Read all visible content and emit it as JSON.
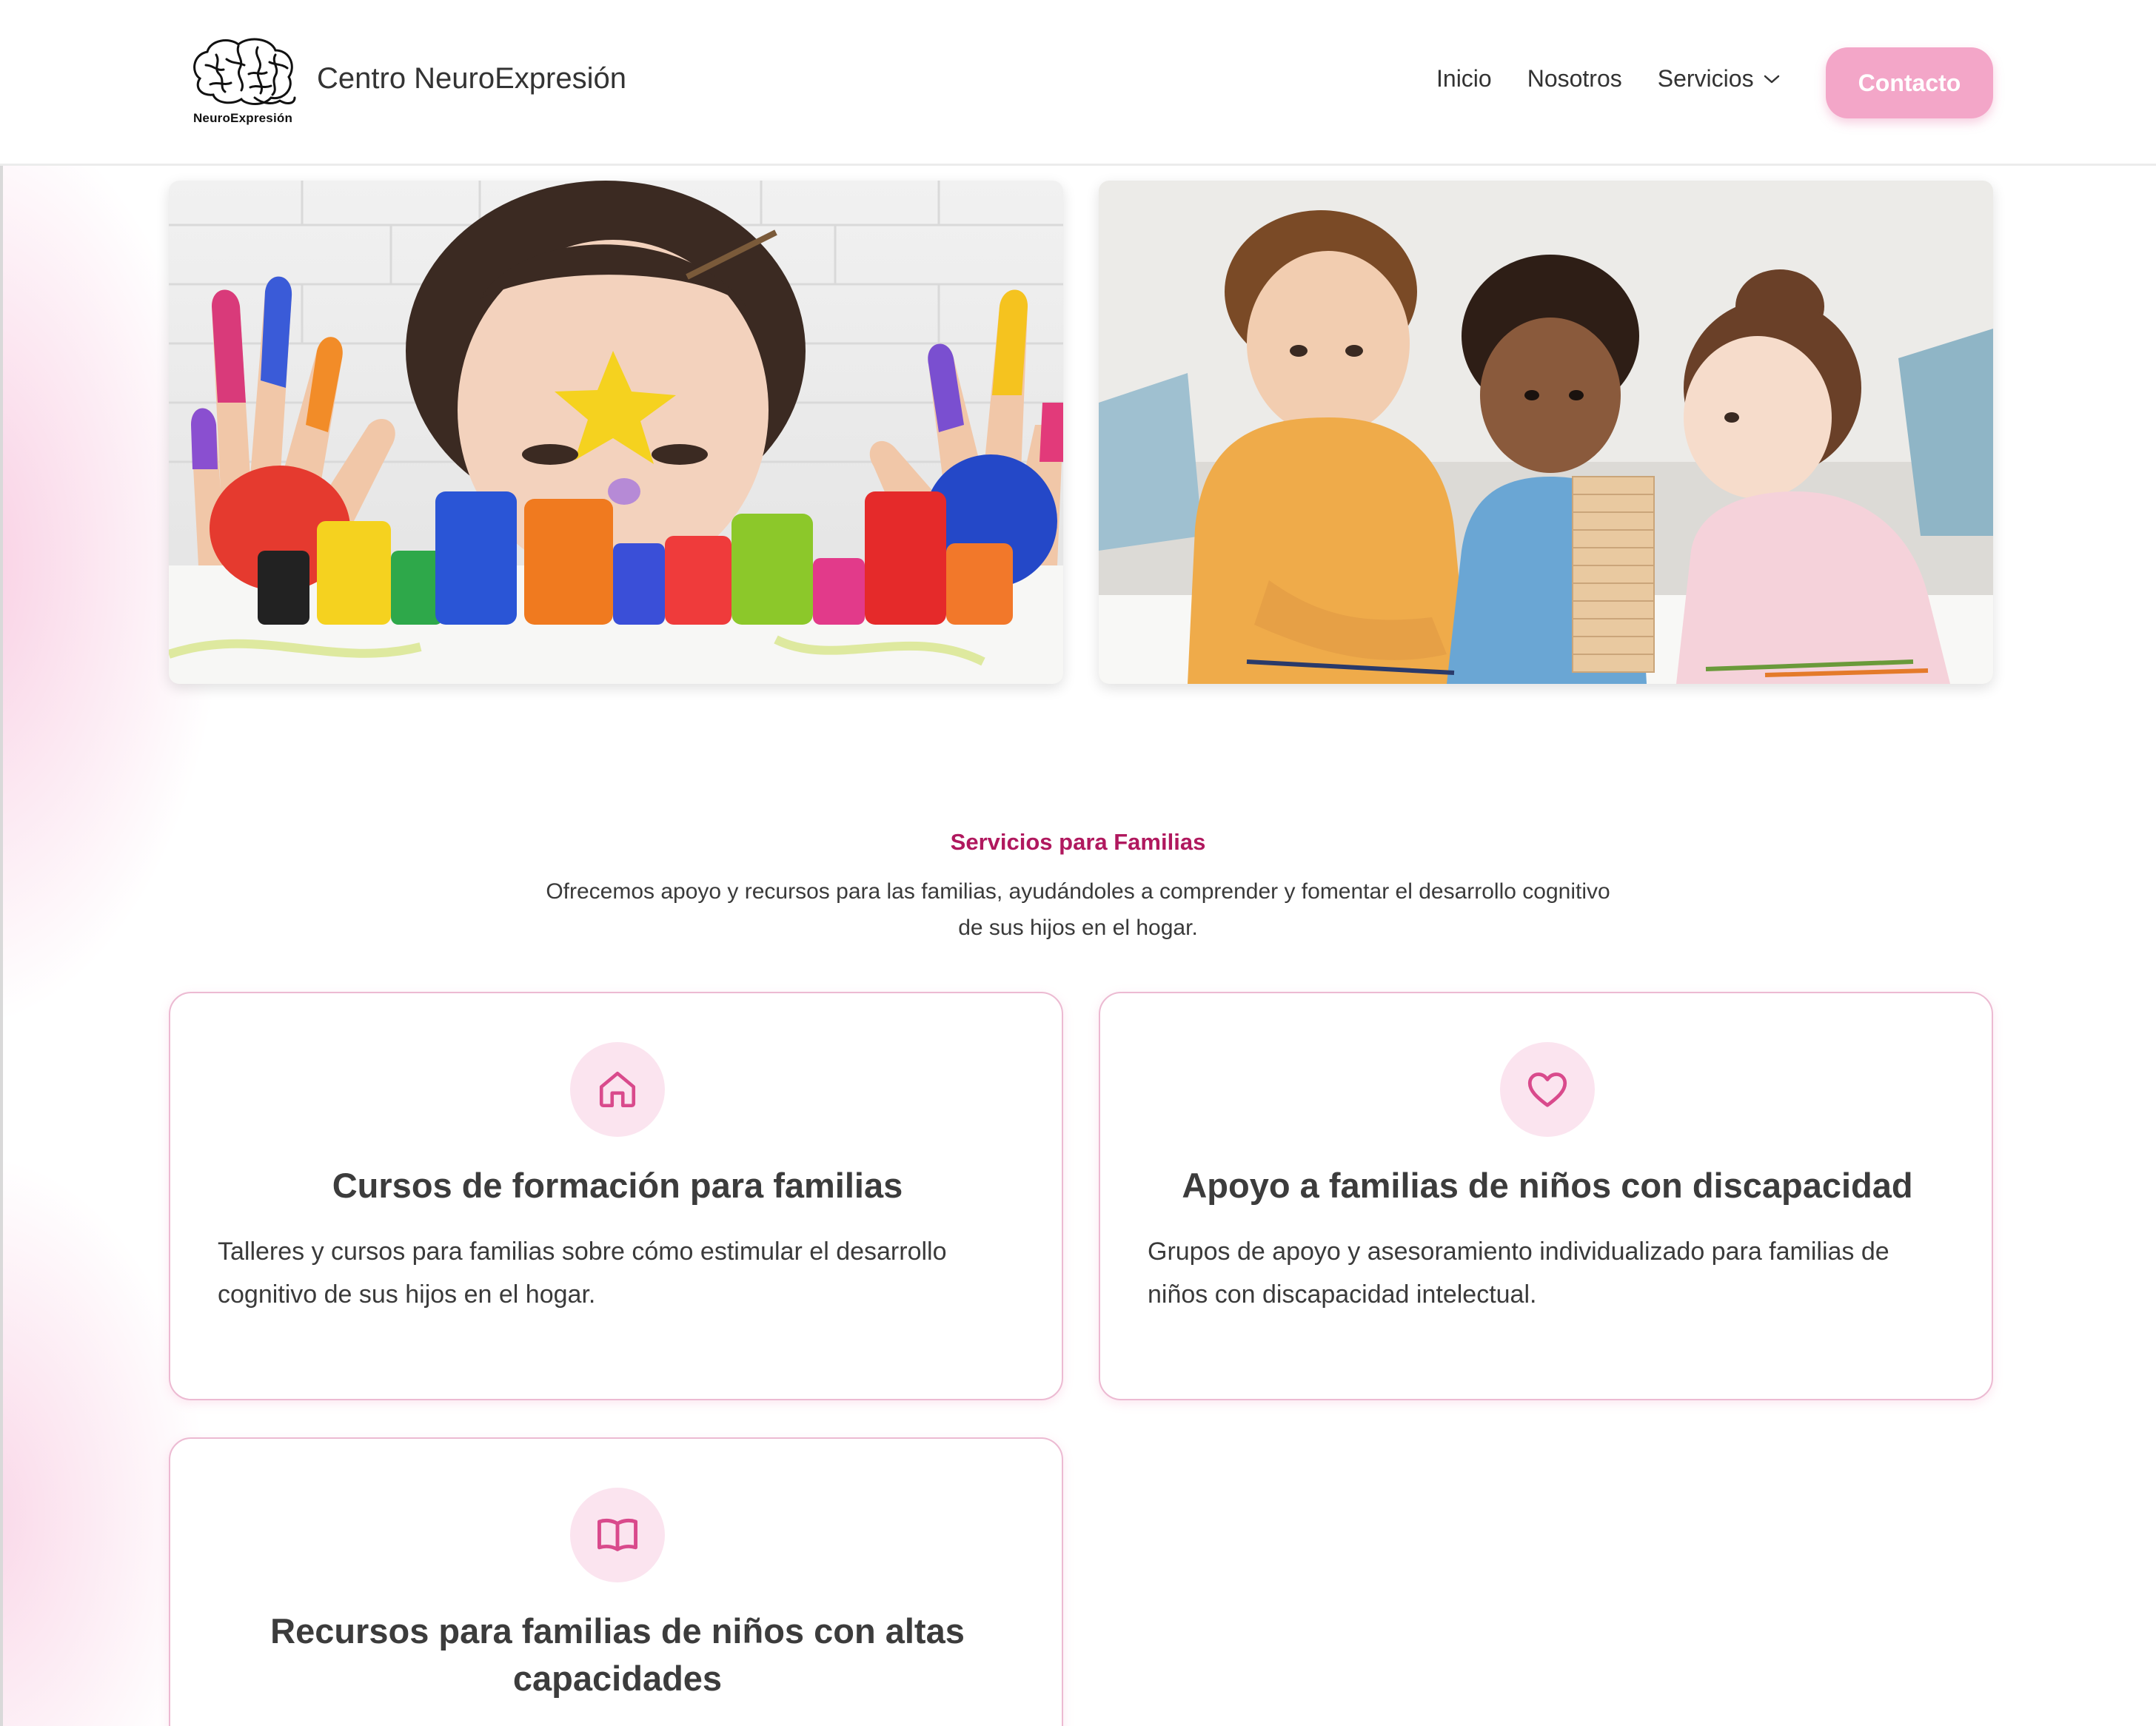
{
  "header": {
    "logo_caption": "NeuroExpresión",
    "brand_name": "Centro NeuroExpresión",
    "nav": [
      {
        "label": "Inicio"
      },
      {
        "label": "Nosotros"
      },
      {
        "label": "Servicios"
      }
    ],
    "contact_label": "Contacto"
  },
  "colors": {
    "accent_pink": "#f3a6c8",
    "section_title": "#b0185e",
    "icon_pink": "#d94a8c",
    "icon_bg": "#fbe4ef",
    "card_border": "#ecbad2"
  },
  "section": {
    "title": "Servicios para Familias",
    "description": "Ofrecemos apoyo y recursos para las familias, ayudándoles a comprender y fomentar el desarrollo cognitivo de sus hijos en el hogar."
  },
  "cards": [
    {
      "icon": "home-icon",
      "title": "Cursos de formación para familias",
      "body": "Talleres y cursos para familias sobre cómo estimular el desarrollo cognitivo de sus hijos en el hogar."
    },
    {
      "icon": "heart-icon",
      "title": "Apoyo a familias de niños con discapacidad",
      "body": "Grupos de apoyo y asesoramiento individualizado para familias de niños con discapacidad intelectual."
    },
    {
      "icon": "book-icon",
      "title": "Recursos para familias de niños con altas capacidades",
      "body": ""
    }
  ]
}
